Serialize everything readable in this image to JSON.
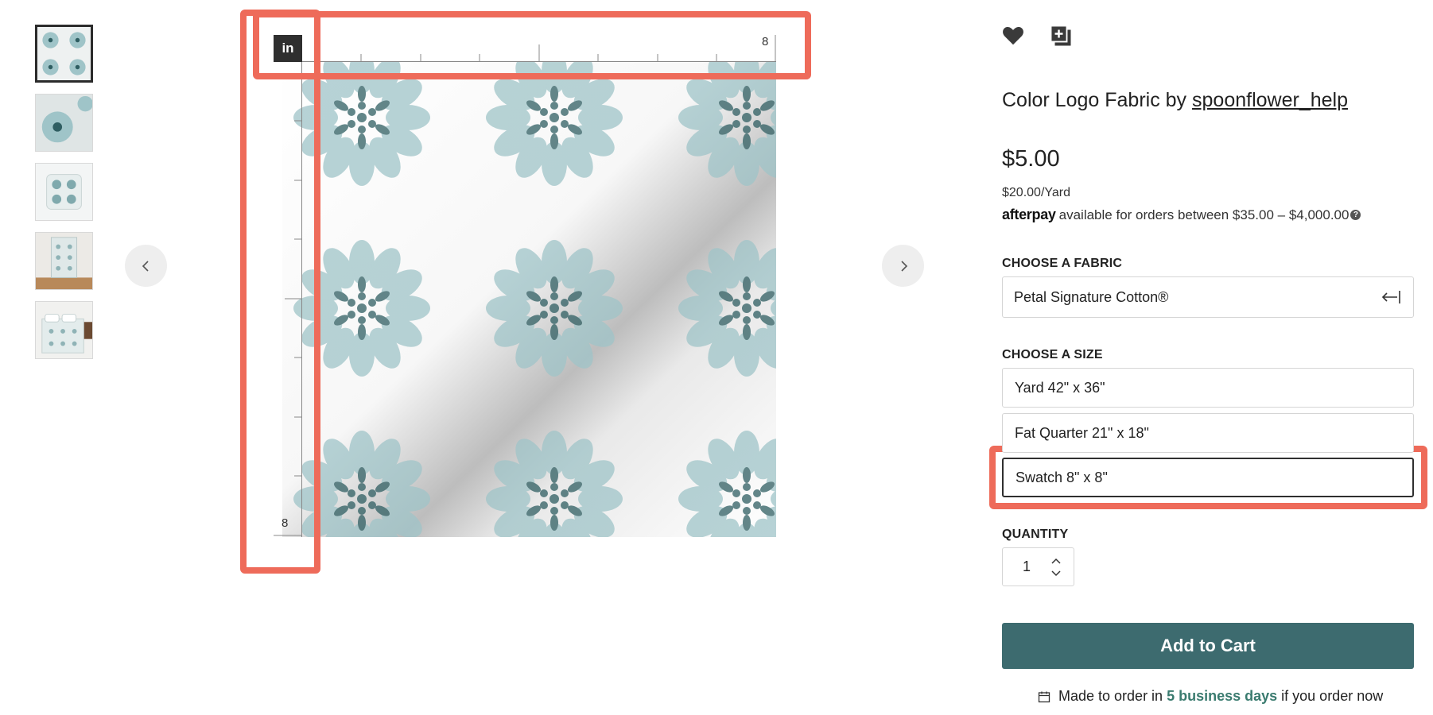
{
  "gallery": {
    "thumbnails": [
      {
        "name": "fabric-swatch-thumb",
        "alt": "Fabric swatch"
      },
      {
        "name": "fabric-closeup-thumb",
        "alt": "Fabric close-up"
      },
      {
        "name": "pillow-thumb",
        "alt": "Pillow"
      },
      {
        "name": "tea-towel-thumb",
        "alt": "Tea towel"
      },
      {
        "name": "bedding-thumb",
        "alt": "Bedding"
      }
    ],
    "ruler_unit": "in",
    "ruler_top_label": "8",
    "ruler_left_label": "8"
  },
  "product": {
    "title_prefix": "Color Logo Fabric by ",
    "designer": "spoonflower_help",
    "price": "$5.00",
    "per_yard": "$20.00/Yard",
    "afterpay_logo": "afterpay",
    "afterpay_text": "available for orders between $35.00 – $4,000.00"
  },
  "fabric": {
    "label": "CHOOSE A FABRIC",
    "selected": "Petal Signature Cotton®"
  },
  "size": {
    "label": "CHOOSE A SIZE",
    "options": [
      "Yard 42\" x 36\"",
      "Fat Quarter 21\" x 18\"",
      "Swatch 8\" x 8\""
    ],
    "selected_index": 2
  },
  "quantity": {
    "label": "QUANTITY",
    "value": "1"
  },
  "cart": {
    "button_label": "Add to Cart",
    "made_prefix": "Made to order in",
    "days": "5 business days",
    "made_suffix": "if you order now"
  },
  "colors": {
    "accent": "#3d6b6f",
    "petal_light": "#9fc4c8",
    "petal_dark": "#2f5e62",
    "highlight": "#ee6b5a"
  },
  "icons": [
    "heart-icon",
    "add-to-collection-icon",
    "chevron-left-icon",
    "chevron-right-icon",
    "collapse-arrow-icon",
    "calendar-icon",
    "help-icon"
  ]
}
